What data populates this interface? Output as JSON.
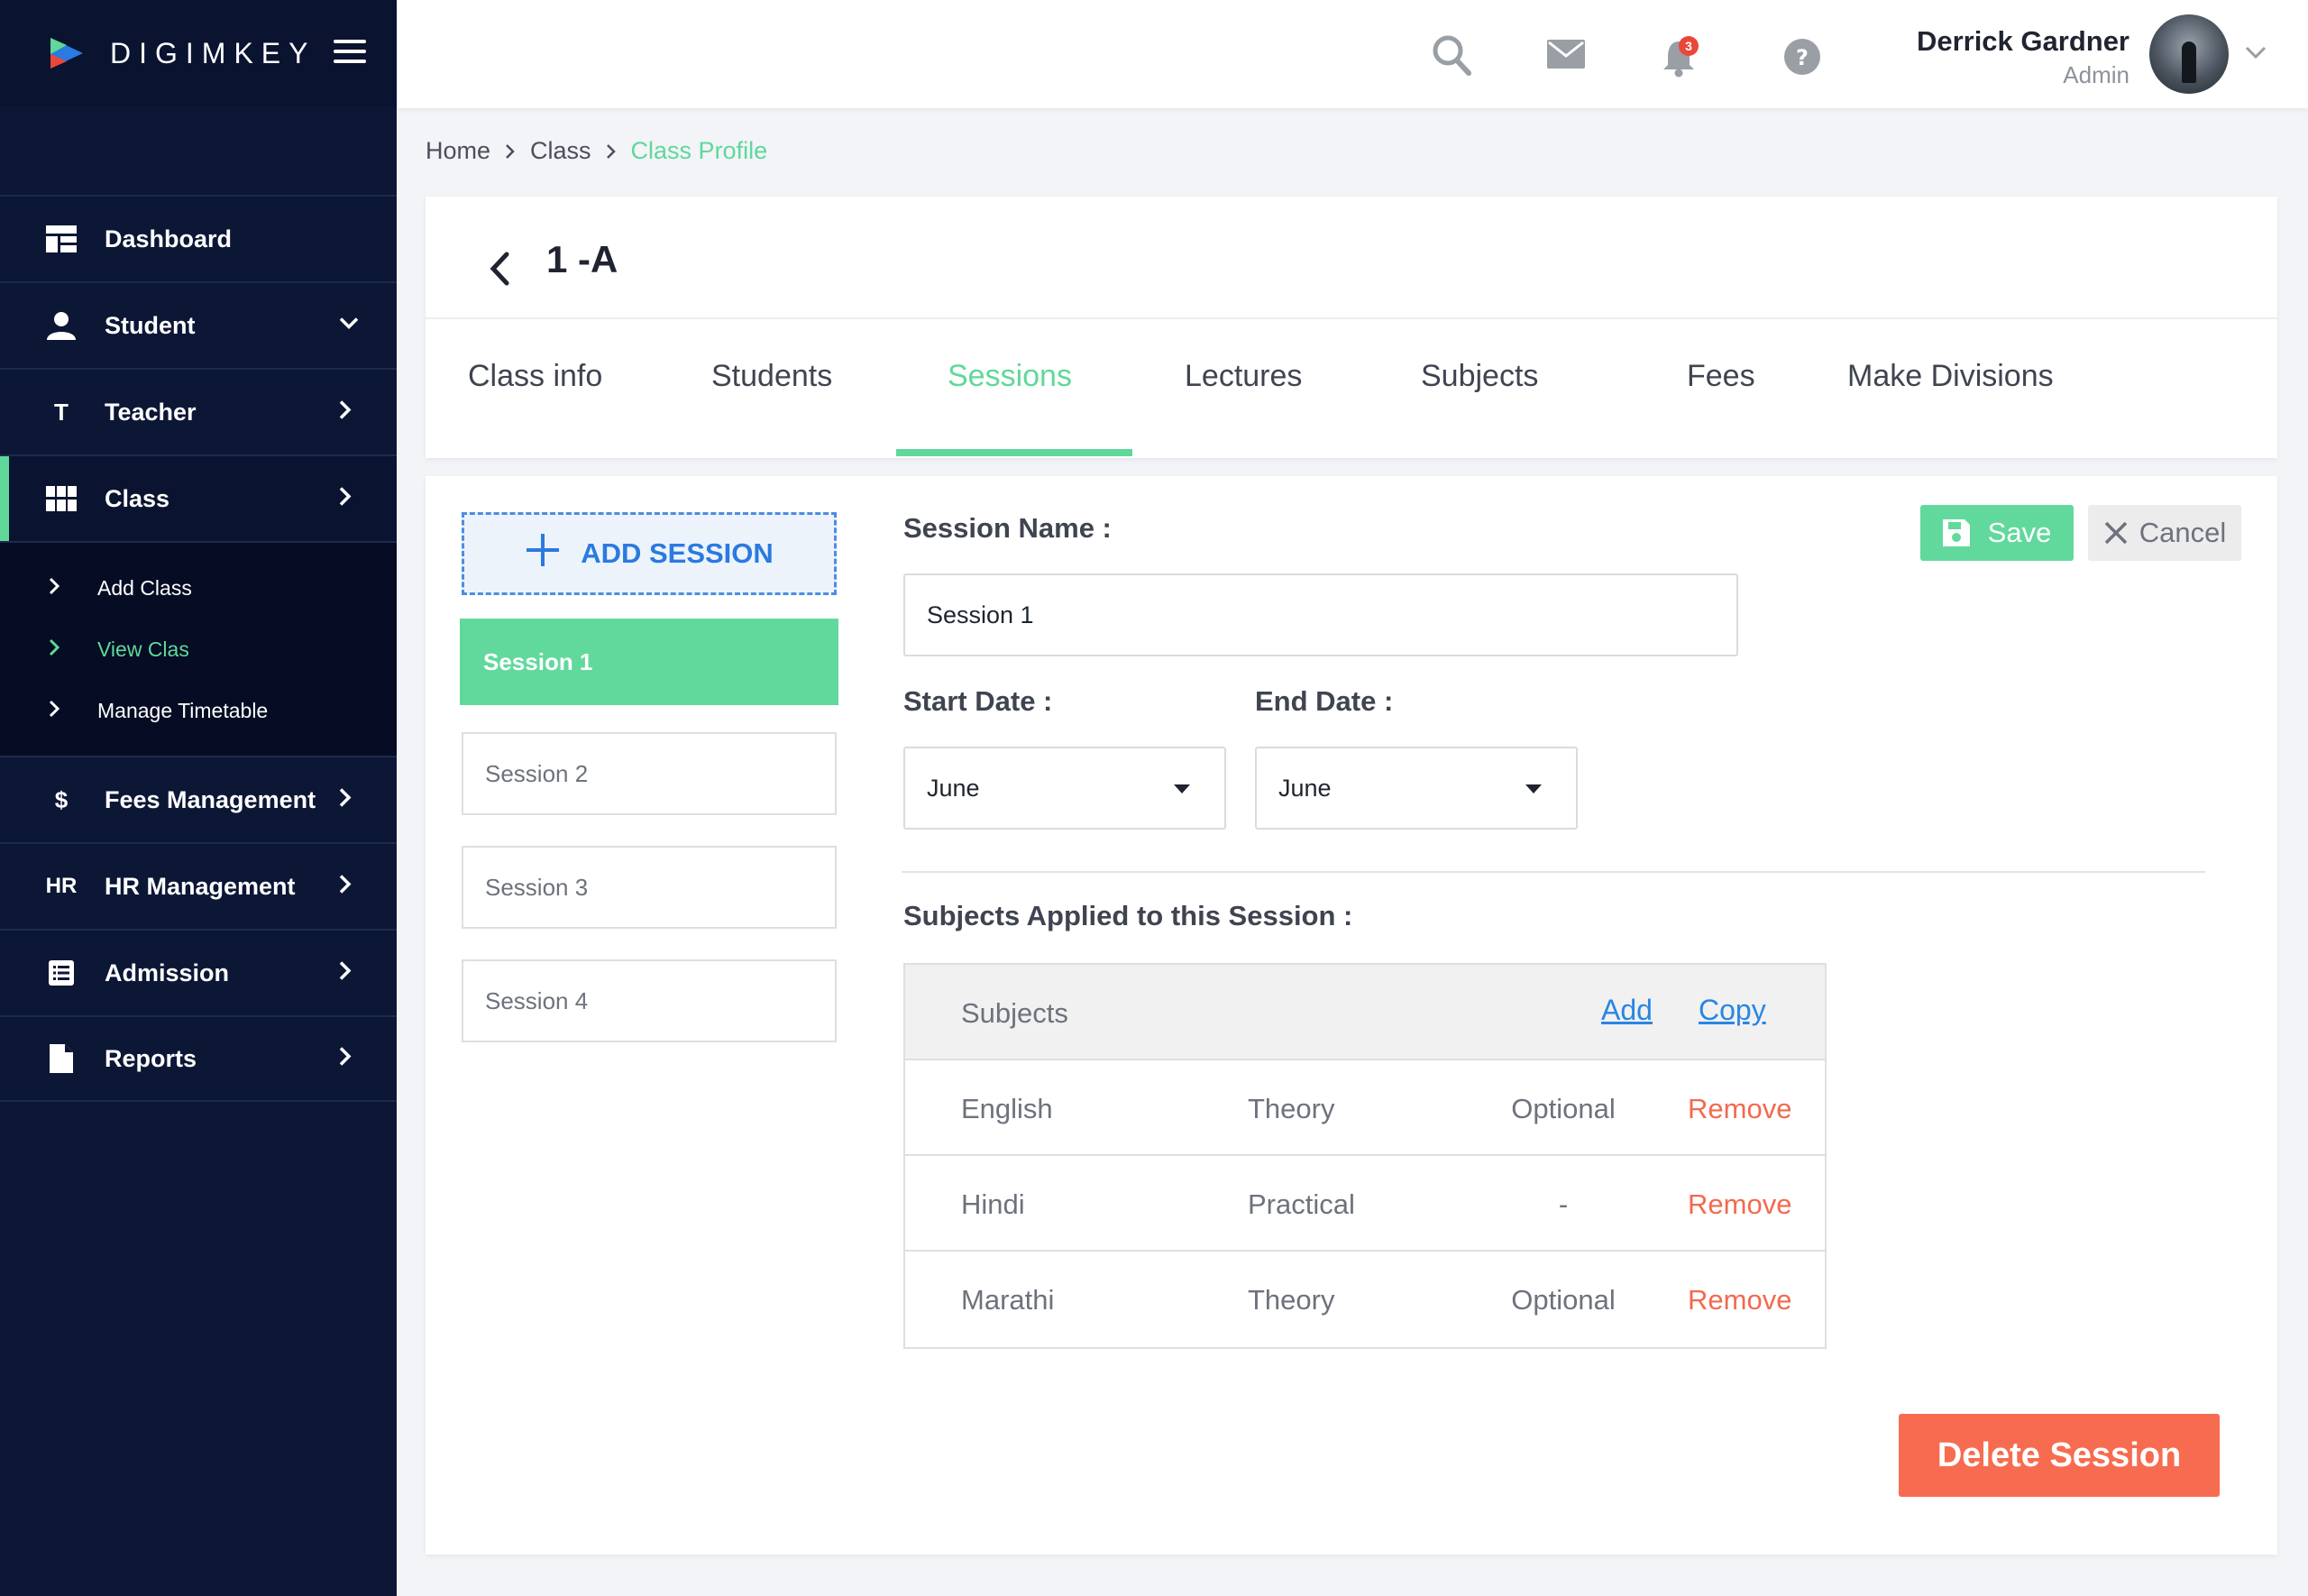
{
  "app": {
    "logo_text": "DIGIMKEY"
  },
  "sidebar": {
    "items": [
      {
        "label": "Dashboard",
        "icon": "dashboard-icon"
      },
      {
        "label": "Student",
        "icon": "user-icon"
      },
      {
        "label": "Teacher",
        "icon": "T"
      },
      {
        "label": "Class",
        "icon": "grid-icon"
      },
      {
        "label": "Fees Management",
        "icon": "$"
      },
      {
        "label": "HR Management",
        "icon": "HR"
      },
      {
        "label": "Admission",
        "icon": "list-icon"
      },
      {
        "label": "Reports",
        "icon": "file-icon"
      }
    ],
    "class_submenu": [
      {
        "label": "Add Class"
      },
      {
        "label": "View Clas"
      },
      {
        "label": "Manage Timetable"
      }
    ]
  },
  "topbar": {
    "notification_count": "3",
    "user_name": "Derrick Gardner",
    "user_role": "Admin"
  },
  "breadcrumb": {
    "home": "Home",
    "class": "Class",
    "current": "Class Profile"
  },
  "header": {
    "class_title": "1 -A",
    "tabs": [
      {
        "label": "Class info"
      },
      {
        "label": "Students"
      },
      {
        "label": "Sessions"
      },
      {
        "label": "Lectures"
      },
      {
        "label": "Subjects"
      },
      {
        "label": "Fees"
      },
      {
        "label": "Make Divisions"
      }
    ]
  },
  "sessions": {
    "add_label": "ADD SESSION",
    "list": [
      {
        "label": "Session 1"
      },
      {
        "label": "Session 2"
      },
      {
        "label": "Session 3"
      },
      {
        "label": "Session 4"
      }
    ]
  },
  "form": {
    "session_name_label": "Session Name :",
    "session_name_value": "Session 1",
    "start_date_label": "Start Date :",
    "start_date_value": "June",
    "end_date_label": "End Date :",
    "end_date_value": "June",
    "save_label": "Save",
    "cancel_label": "Cancel",
    "subjects_section_label": "Subjects Applied to this Session :",
    "delete_label": "Delete Session"
  },
  "subjects_table": {
    "header": "Subjects",
    "add_link": "Add",
    "copy_link": "Copy",
    "rows": [
      {
        "subject": "English",
        "type": "Theory",
        "status": "Optional",
        "action": "Remove"
      },
      {
        "subject": "Hindi",
        "type": "Practical",
        "status": "-",
        "action": "Remove"
      },
      {
        "subject": "Marathi",
        "type": "Theory",
        "status": "Optional",
        "action": "Remove"
      }
    ]
  },
  "colors": {
    "sidebar_bg": "#0c1736",
    "accent_green": "#5fd89a",
    "link_blue": "#2a86e3",
    "danger": "#f76c50"
  }
}
